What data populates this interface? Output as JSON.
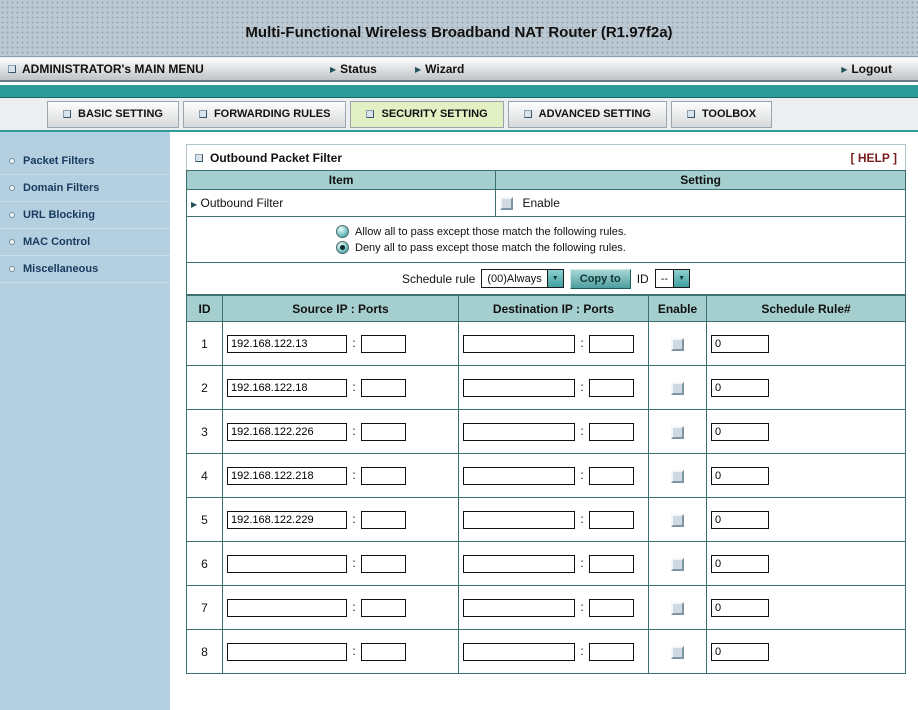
{
  "theme": {
    "accent": "#2E9B9B",
    "table-header-bg": "#A5CECE",
    "tab-active-bg": "#E3F0C3",
    "sidebar-bg": "#B4CFDF",
    "banner-bg": "#BCC9D2"
  },
  "header": {
    "title": "Multi-Functional Wireless Broadband NAT Router (R1.97f2a)"
  },
  "menubar": {
    "title": "ADMINISTRATOR's MAIN MENU",
    "status": "Status",
    "wizard": "Wizard",
    "logout": "Logout"
  },
  "tabs": [
    {
      "label": "BASIC SETTING"
    },
    {
      "label": "FORWARDING RULES"
    },
    {
      "label": "SECURITY SETTING"
    },
    {
      "label": "ADVANCED SETTING"
    },
    {
      "label": "TOOLBOX"
    }
  ],
  "sidebar": {
    "items": [
      {
        "label": "Packet Filters"
      },
      {
        "label": "Domain Filters"
      },
      {
        "label": "URL Blocking"
      },
      {
        "label": "MAC Control"
      },
      {
        "label": "Miscellaneous"
      }
    ]
  },
  "main": {
    "panel_title": "Outbound Packet Filter",
    "help_label": "[ HELP ]",
    "item_header": "Item",
    "setting_header": "Setting",
    "outbound_filter_label": "Outbound Filter",
    "enable_label": "Enable",
    "policy_options": [
      {
        "label": "Allow all to pass except those match the following rules.",
        "selected": false
      },
      {
        "label": "Deny all to pass except those match the following rules.",
        "selected": true
      }
    ],
    "schedule": {
      "label": "Schedule rule",
      "value": "(00)Always",
      "copy_button": "Copy to",
      "id_label": "ID",
      "id_value": "--"
    },
    "table": {
      "headers": {
        "id": "ID",
        "source": "Source IP : Ports",
        "destination": "Destination IP : Ports",
        "enable": "Enable",
        "schedule": "Schedule Rule#"
      },
      "rows": [
        {
          "id": "1",
          "src_ip": "192.168.122.13",
          "src_port": "",
          "dst_ip": "",
          "dst_port": "",
          "enabled": false,
          "schedule_rule": "0"
        },
        {
          "id": "2",
          "src_ip": "192.168.122.18",
          "src_port": "",
          "dst_ip": "",
          "dst_port": "",
          "enabled": false,
          "schedule_rule": "0"
        },
        {
          "id": "3",
          "src_ip": "192.168.122.226",
          "src_port": "",
          "dst_ip": "",
          "dst_port": "",
          "enabled": false,
          "schedule_rule": "0"
        },
        {
          "id": "4",
          "src_ip": "192.168.122.218",
          "src_port": "",
          "dst_ip": "",
          "dst_port": "",
          "enabled": false,
          "schedule_rule": "0"
        },
        {
          "id": "5",
          "src_ip": "192.168.122.229",
          "src_port": "",
          "dst_ip": "",
          "dst_port": "",
          "enabled": false,
          "schedule_rule": "0"
        },
        {
          "id": "6",
          "src_ip": "",
          "src_port": "",
          "dst_ip": "",
          "dst_port": "",
          "enabled": false,
          "schedule_rule": "0"
        },
        {
          "id": "7",
          "src_ip": "",
          "src_port": "",
          "dst_ip": "",
          "dst_port": "",
          "enabled": false,
          "schedule_rule": "0"
        },
        {
          "id": "8",
          "src_ip": "",
          "src_port": "",
          "dst_ip": "",
          "dst_port": "",
          "enabled": false,
          "schedule_rule": "0"
        }
      ]
    }
  }
}
